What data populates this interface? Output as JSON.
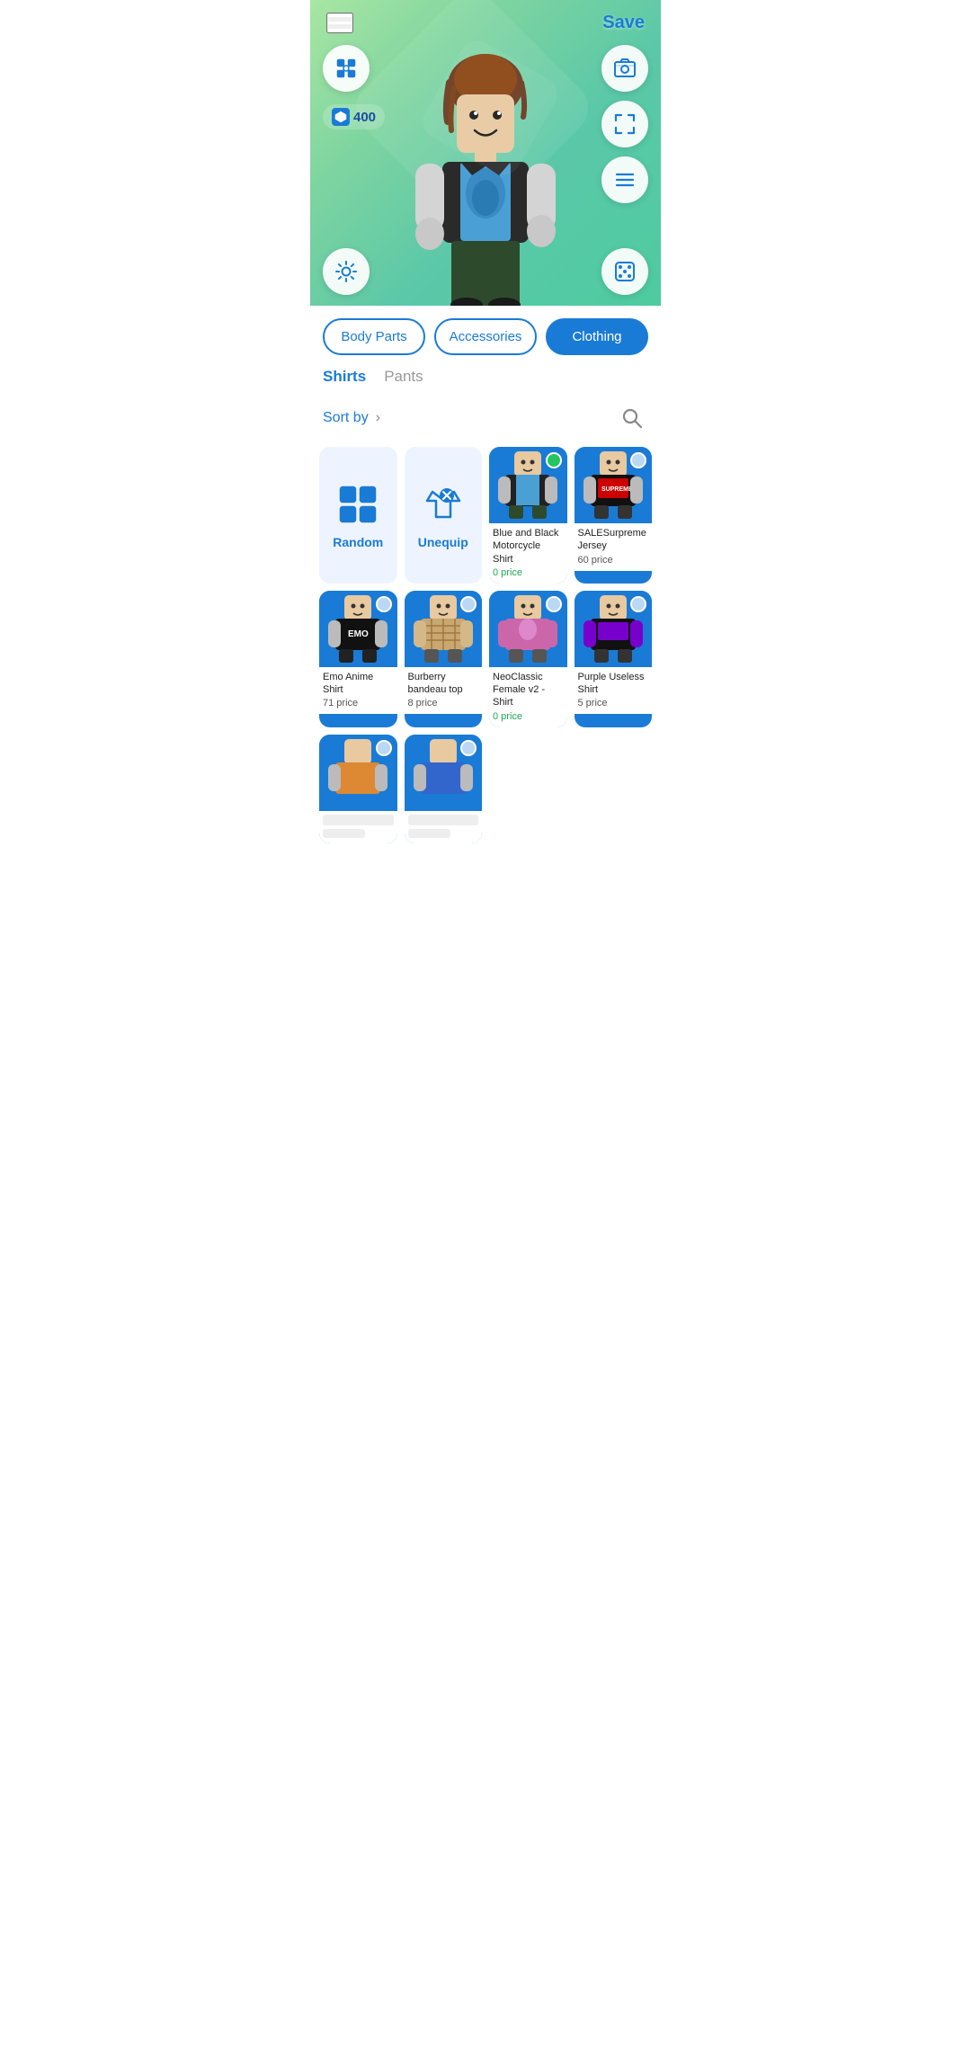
{
  "app": {
    "save_label": "Save",
    "robux_count": "400"
  },
  "categories": [
    {
      "id": "body-parts",
      "label": "Body Parts",
      "active": false
    },
    {
      "id": "accessories",
      "label": "Accessories",
      "active": false
    },
    {
      "id": "clothing",
      "label": "Clothing",
      "active": true
    }
  ],
  "sub_tabs": [
    {
      "id": "shirts",
      "label": "Shirts",
      "active": true
    },
    {
      "id": "pants",
      "label": "Pants",
      "active": false
    }
  ],
  "sort_by": {
    "label": "Sort by",
    "chevron": "›"
  },
  "items": [
    {
      "id": "random",
      "type": "special",
      "label": "Random",
      "price": null,
      "selected": false
    },
    {
      "id": "unequip",
      "type": "special",
      "label": "Unequip",
      "price": null,
      "selected": false
    },
    {
      "id": "blue-black-moto",
      "type": "catalog",
      "name": "Blue and Black Motorcycle Shirt",
      "price": "0 price",
      "price_free": true,
      "selected": true
    },
    {
      "id": "sale-supreme",
      "type": "catalog",
      "name": "SALESurpreme Jersey",
      "price": "60 price",
      "price_free": false,
      "selected": false
    },
    {
      "id": "emo-anime",
      "type": "catalog",
      "name": "Emo Anime Shirt",
      "price": "71 price",
      "price_free": false,
      "selected": false
    },
    {
      "id": "burberry",
      "type": "catalog",
      "name": "Burberry bandeau top",
      "price": "8 price",
      "price_free": false,
      "selected": false
    },
    {
      "id": "neoclassic-female",
      "type": "catalog",
      "name": "NeoClassic Female v2 - Shirt",
      "price": "0 price",
      "price_free": true,
      "selected": false
    },
    {
      "id": "purple-useless",
      "type": "catalog",
      "name": "Purple Useless Shirt",
      "price": "5 price",
      "price_free": false,
      "selected": false
    },
    {
      "id": "item9",
      "type": "catalog",
      "name": "",
      "price": "",
      "price_free": false,
      "selected": false
    },
    {
      "id": "item10",
      "type": "catalog",
      "name": "",
      "price": "",
      "price_free": false,
      "selected": false
    }
  ],
  "icons": {
    "hamburger": "☰",
    "search": "🔍",
    "robux_symbol": "⬡"
  },
  "colors": {
    "primary_blue": "#1a7bd6",
    "active_green": "#22c55e",
    "bg_gradient_start": "#a8e6a3",
    "bg_gradient_end": "#4ecba0",
    "card_bg": "#1a7bd6",
    "special_card_bg": "#eef4ff",
    "free_price": "#22a855"
  }
}
